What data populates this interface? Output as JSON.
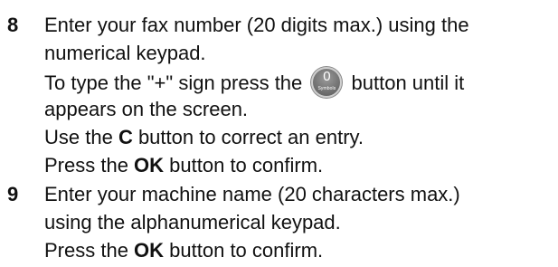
{
  "steps": [
    {
      "number": "8",
      "lines": {
        "l1": "Enter your fax number (20 digits max.) using the",
        "l2": "numerical keypad.",
        "l3_before": "To type the \"+\" sign press the",
        "l3_after": "button until it",
        "l4": "appears on the screen.",
        "l5_before": "Use the ",
        "l5_bold": "C",
        "l5_after": " button to correct an entry.",
        "l6_before": "Press the ",
        "l6_bold": "OK",
        "l6_after": " button to confirm."
      },
      "key": {
        "icon": "zero-symbols-key-icon",
        "top_label": "0",
        "sub_label": "Symbols"
      }
    },
    {
      "number": "9",
      "lines": {
        "l1": "Enter your machine name (20 characters max.)",
        "l2": "using the alphanumerical keypad.",
        "l3_before": "Press the ",
        "l3_bold": "OK",
        "l3_after": " button to confirm."
      }
    }
  ]
}
